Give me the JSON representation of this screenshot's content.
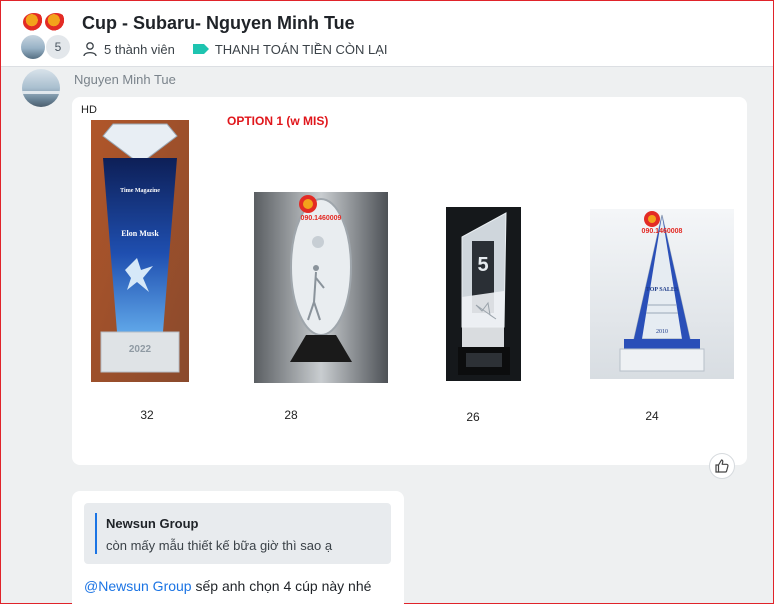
{
  "header": {
    "title": "Cup - Subaru- Nguyen Minh Tue",
    "member_count_badge": "5",
    "members_label": "5 thành viên",
    "tag_label": "THANH TOÁN TIỀN CÒN LẠI",
    "tag_color": "#1ec4b0"
  },
  "message": {
    "sender": "Nguyen Minh Tue",
    "image": {
      "corner_label": "HD",
      "option_label": "OPTION 1 (w MIS)",
      "trophies": [
        {
          "name": "diamond-blue-trophy",
          "price": "32",
          "engraving_title": "Time Magazine",
          "engraving_name": "Elon Musk",
          "engraving_year": "2022"
        },
        {
          "name": "oval-crystal-golf-trophy",
          "price": "28",
          "watermark_phone": "090.1460009"
        },
        {
          "name": "number-five-trophy",
          "price": "26",
          "engraving_number": "5"
        },
        {
          "name": "pyramid-crystal-trophy",
          "price": "24",
          "watermark_phone": "090.1460008",
          "engraving_title": "TOP SALES",
          "engraving_year": "2010"
        }
      ]
    }
  },
  "reply": {
    "quote_sender": "Newsun Group",
    "quote_text": "còn mấy mẫu thiết kế bữa giờ thì sao ạ",
    "mention": "@Newsun Group",
    "text": " sếp anh chọn 4 cúp này nhé"
  },
  "icons": {
    "user": "user-icon",
    "tag": "tag-icon",
    "like": "thumbs-up-icon"
  }
}
